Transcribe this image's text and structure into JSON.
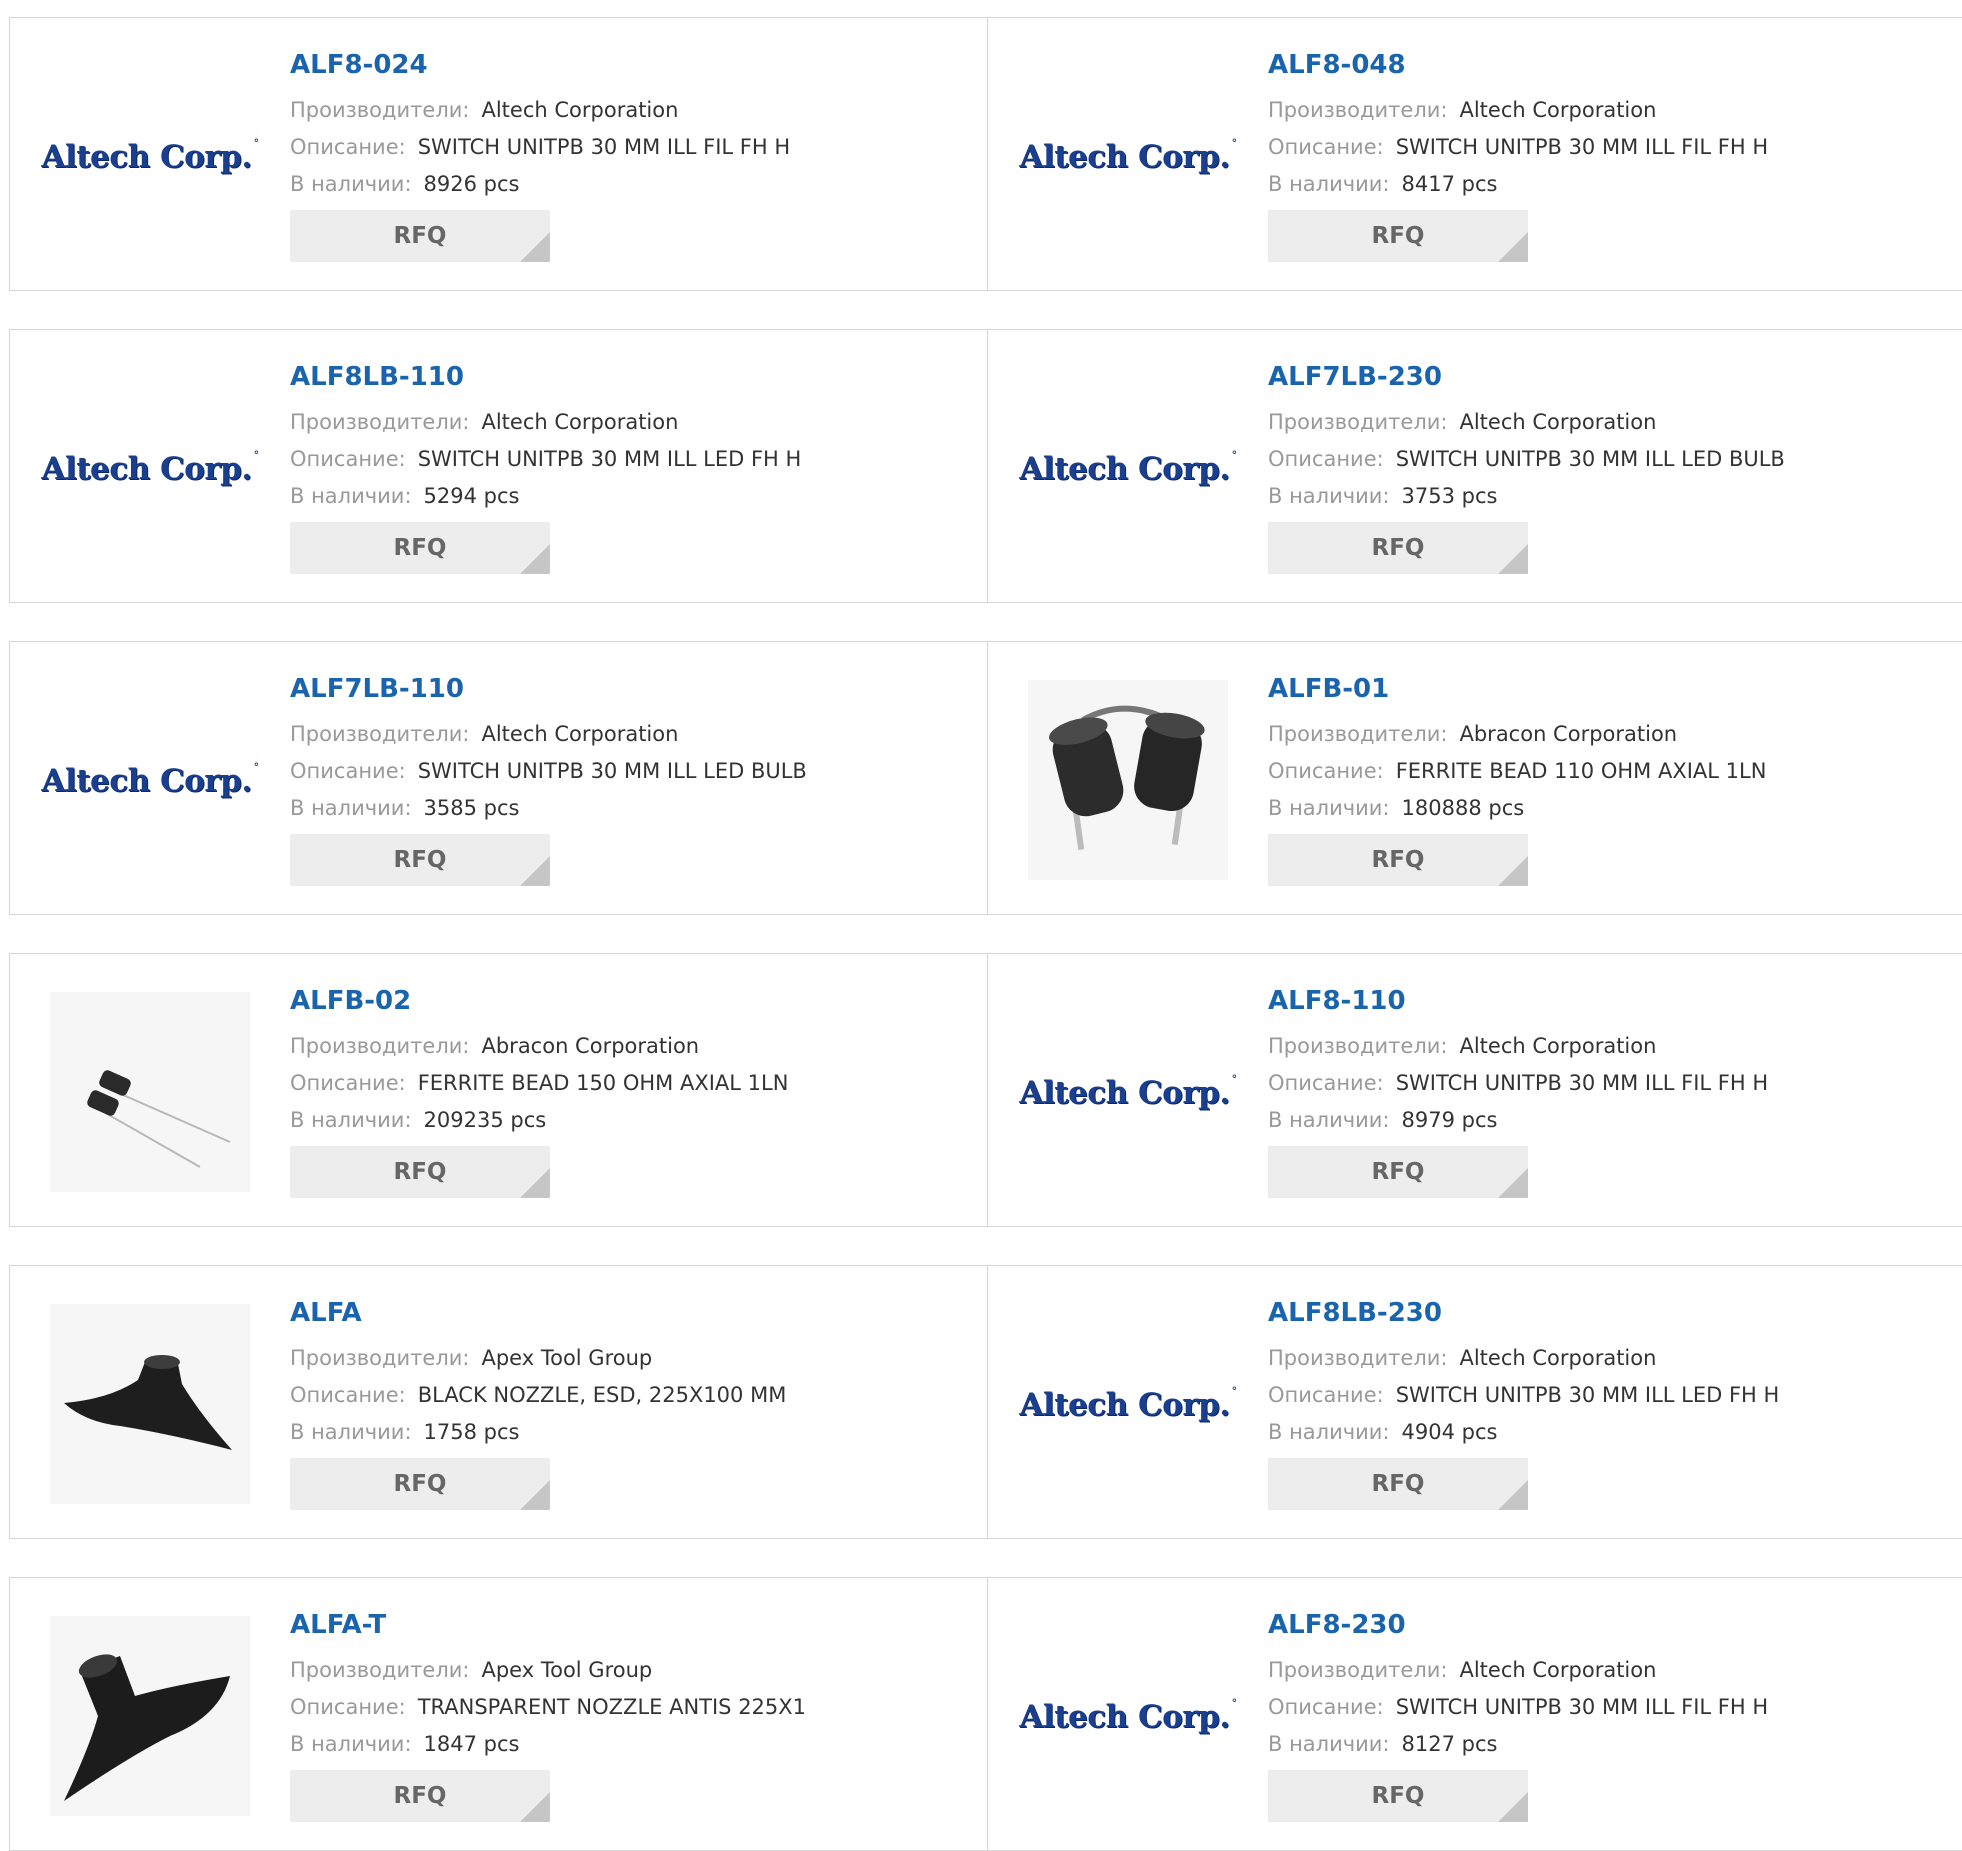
{
  "labels": {
    "manufacturer": "Производители:",
    "description": "Описание:",
    "stock": "В наличии:",
    "rfq": "RFQ"
  },
  "brand_logo": {
    "text": "Altech Corp.",
    "mark": "°",
    "color": "#1a3f8f"
  },
  "colors": {
    "part_link": "#1a63ad",
    "label": "#999999",
    "rfq_bg": "#ededed",
    "border": "#d6d6d6"
  },
  "products": [
    {
      "part": "ALF8-024",
      "manufacturer": "Altech Corporation",
      "description": "SWITCH UNITPB 30 MM ILL FIL FH H",
      "stock": "8926 pcs",
      "image": "altech-logo"
    },
    {
      "part": "ALF8-048",
      "manufacturer": "Altech Corporation",
      "description": "SWITCH UNITPB 30 MM ILL FIL FH H",
      "stock": "8417 pcs",
      "image": "altech-logo"
    },
    {
      "part": "ALF8LB-110",
      "manufacturer": "Altech Corporation",
      "description": "SWITCH UNITPB 30 MM ILL LED FH H",
      "stock": "5294 pcs",
      "image": "altech-logo"
    },
    {
      "part": "ALF7LB-230",
      "manufacturer": "Altech Corporation",
      "description": "SWITCH UNITPB 30 MM ILL LED BULB",
      "stock": "3753 pcs",
      "image": "altech-logo"
    },
    {
      "part": "ALF7LB-110",
      "manufacturer": "Altech Corporation",
      "description": "SWITCH UNITPB 30 MM ILL LED BULB",
      "stock": "3585 pcs",
      "image": "altech-logo"
    },
    {
      "part": "ALFB-01",
      "manufacturer": "Abracon Corporation",
      "description": "FERRITE BEAD 110 OHM AXIAL 1LN",
      "stock": "180888 pcs",
      "image": "ferrite-bead-large"
    },
    {
      "part": "ALFB-02",
      "manufacturer": "Abracon Corporation",
      "description": "FERRITE BEAD 150 OHM AXIAL 1LN",
      "stock": "209235 pcs",
      "image": "ferrite-bead-small"
    },
    {
      "part": "ALF8-110",
      "manufacturer": "Altech Corporation",
      "description": "SWITCH UNITPB 30 MM ILL FIL FH H",
      "stock": "8979 pcs",
      "image": "altech-logo"
    },
    {
      "part": "ALFA",
      "manufacturer": "Apex Tool Group",
      "description": "BLACK NOZZLE, ESD, 225X100 MM",
      "stock": "1758 pcs",
      "image": "nozzle-flat"
    },
    {
      "part": "ALF8LB-230",
      "manufacturer": "Altech Corporation",
      "description": "SWITCH UNITPB 30 MM ILL LED FH H",
      "stock": "4904 pcs",
      "image": "altech-logo"
    },
    {
      "part": "ALFA-T",
      "manufacturer": "Apex Tool Group",
      "description": "TRANSPARENT NOZZLE ANTIS 225X1",
      "stock": "1847 pcs",
      "image": "nozzle-angled"
    },
    {
      "part": "ALF8-230",
      "manufacturer": "Altech Corporation",
      "description": "SWITCH UNITPB 30 MM ILL FIL FH H",
      "stock": "8127 pcs",
      "image": "altech-logo"
    }
  ]
}
